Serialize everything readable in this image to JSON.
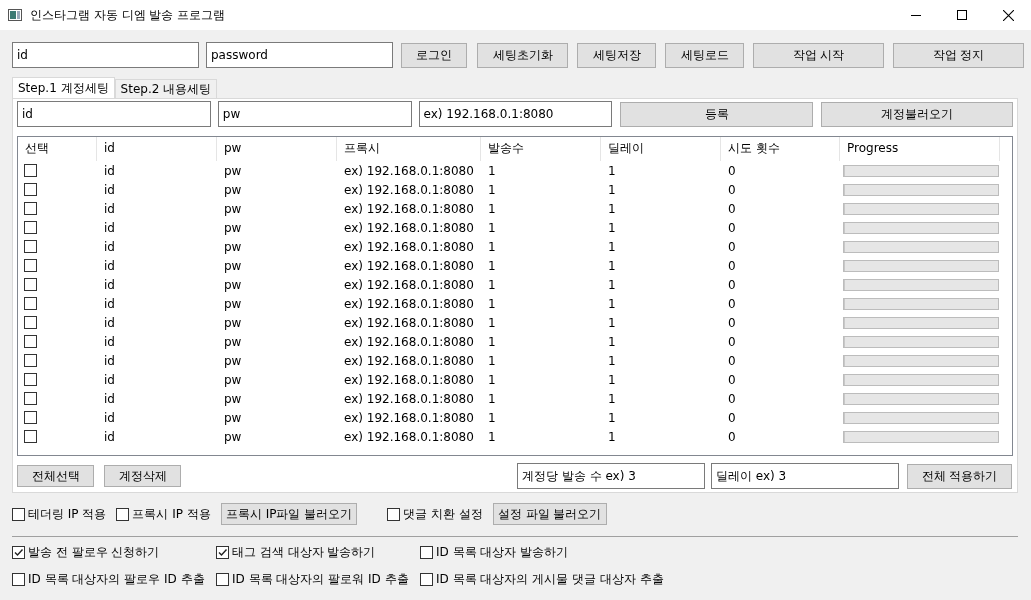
{
  "window": {
    "title": "인스타그램 자동 디엠 발송 프로그램"
  },
  "login": {
    "fields": [
      {
        "value": "id"
      },
      {
        "value": "password"
      }
    ],
    "buttons": [
      "로그인",
      "세팅초기화",
      "세팅저장",
      "세팅로드",
      "작업 시작",
      "작업 정지"
    ]
  },
  "tabs": [
    {
      "label": "Step.1 계정세팅",
      "selected": true
    },
    {
      "label": "Step.2 내용세팅",
      "selected": false
    }
  ],
  "account_form": {
    "fields": [
      {
        "value": "id"
      },
      {
        "value": "pw"
      },
      {
        "value": "ex) 192.168.0.1:8080"
      }
    ],
    "buttons": [
      "등록",
      "계정불러오기"
    ]
  },
  "table": {
    "columns": [
      "선택",
      "id",
      "pw",
      "프록시",
      "발송수",
      "딜레이",
      "시도 횟수",
      "Progress"
    ],
    "rows": [
      {
        "checked": false,
        "id": "id",
        "pw": "pw",
        "proxy": "ex) 192.168.0.1:8080",
        "send_count": "1",
        "delay": "1",
        "attempts": "0",
        "level": 0
      },
      {
        "checked": false,
        "id": "id",
        "pw": "pw",
        "proxy": "ex) 192.168.0.1:8080",
        "send_count": "1",
        "delay": "1",
        "attempts": "0",
        "level": 0
      },
      {
        "checked": false,
        "id": "id",
        "pw": "pw",
        "proxy": "ex) 192.168.0.1:8080",
        "send_count": "1",
        "delay": "1",
        "attempts": "0",
        "level": 0
      },
      {
        "checked": false,
        "id": "id",
        "pw": "pw",
        "proxy": "ex) 192.168.0.1:8080",
        "send_count": "1",
        "delay": "1",
        "attempts": "0",
        "level": 0
      },
      {
        "checked": false,
        "id": "id",
        "pw": "pw",
        "proxy": "ex) 192.168.0.1:8080",
        "send_count": "1",
        "delay": "1",
        "attempts": "0",
        "level": 0
      },
      {
        "checked": false,
        "id": "id",
        "pw": "pw",
        "proxy": "ex) 192.168.0.1:8080",
        "send_count": "1",
        "delay": "1",
        "attempts": "0",
        "level": 0
      },
      {
        "checked": false,
        "id": "id",
        "pw": "pw",
        "proxy": "ex) 192.168.0.1:8080",
        "send_count": "1",
        "delay": "1",
        "attempts": "0",
        "level": 0
      },
      {
        "checked": false,
        "id": "id",
        "pw": "pw",
        "proxy": "ex) 192.168.0.1:8080",
        "send_count": "1",
        "delay": "1",
        "attempts": "0",
        "level": 0
      },
      {
        "checked": false,
        "id": "id",
        "pw": "pw",
        "proxy": "ex) 192.168.0.1:8080",
        "send_count": "1",
        "delay": "1",
        "attempts": "0",
        "level": 0
      },
      {
        "checked": false,
        "id": "id",
        "pw": "pw",
        "proxy": "ex) 192.168.0.1:8080",
        "send_count": "1",
        "delay": "1",
        "attempts": "0",
        "level": 0
      },
      {
        "checked": false,
        "id": "id",
        "pw": "pw",
        "proxy": "ex) 192.168.0.1:8080",
        "send_count": "1",
        "delay": "1",
        "attempts": "0",
        "level": 0
      },
      {
        "checked": false,
        "id": "id",
        "pw": "pw",
        "proxy": "ex) 192.168.0.1:8080",
        "send_count": "1",
        "delay": "1",
        "attempts": "0",
        "level": 0
      },
      {
        "checked": false,
        "id": "id",
        "pw": "pw",
        "proxy": "ex) 192.168.0.1:8080",
        "send_count": "1",
        "delay": "1",
        "attempts": "0",
        "level": 0
      },
      {
        "checked": false,
        "id": "id",
        "pw": "pw",
        "proxy": "ex) 192.168.0.1:8080",
        "send_count": "1",
        "delay": "1",
        "attempts": "0",
        "level": 0
      },
      {
        "checked": false,
        "id": "id",
        "pw": "pw",
        "proxy": "ex) 192.168.0.1:8080",
        "send_count": "1",
        "delay": "1",
        "attempts": "0",
        "level": 0
      }
    ]
  },
  "table_actions": {
    "buttons": [
      "전체선택",
      "계정삭제"
    ],
    "fields": [
      {
        "value": "계정당 발송 수 ex) 3"
      },
      {
        "value": "딜레이 ex) 3"
      }
    ],
    "apply_button": "전체 적용하기"
  },
  "options_row": [
    {
      "kind": "checkbox",
      "label": "테더링 IP 적용",
      "checked": false
    },
    {
      "kind": "checkbox",
      "label": "프록시 IP 적용",
      "checked": false
    },
    {
      "kind": "button",
      "label": "프록시 IP파일 불러오기"
    },
    {
      "kind": "checkbox",
      "label": "댓글 치환 설정",
      "checked": false
    },
    {
      "kind": "button",
      "label": "설정 파일 불러오기"
    }
  ],
  "send_options": [
    {
      "label": "발송 전 팔로우 신청하기",
      "checked": true
    },
    {
      "label": "태그 검색 대상자 발송하기",
      "checked": true
    },
    {
      "label": "ID 목록 대상자 발송하기",
      "checked": false
    },
    {
      "label": "ID 목록 대상자의 팔로우 ID 추출",
      "checked": false
    },
    {
      "label": "ID 목록 대상자의 팔로워 ID 추출",
      "checked": false
    },
    {
      "label": "ID 목록 대상자의 게시물 댓글 대상자 추출",
      "checked": false
    }
  ]
}
